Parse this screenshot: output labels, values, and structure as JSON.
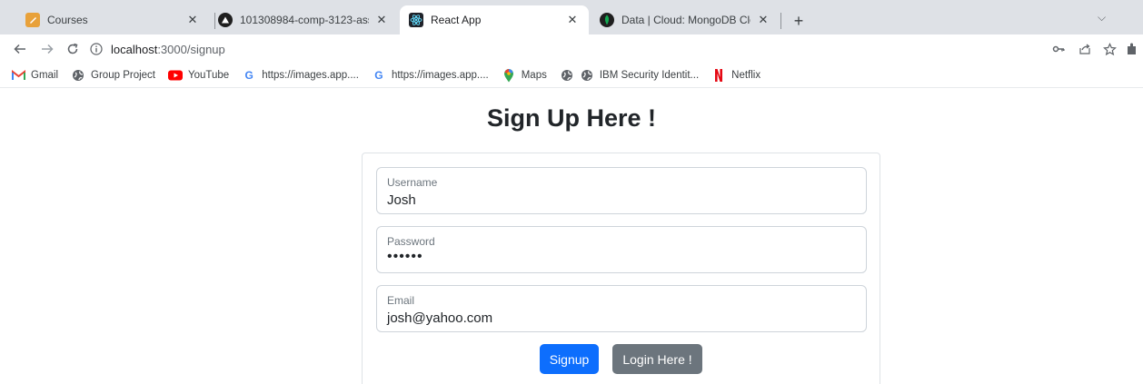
{
  "browser": {
    "tabs": [
      {
        "title": "Courses",
        "active": false
      },
      {
        "title": "101308984-comp-3123-assignme",
        "active": false
      },
      {
        "title": "React App",
        "active": true
      },
      {
        "title": "Data | Cloud: MongoDB Cloud",
        "active": false
      }
    ],
    "close_glyph": "✕",
    "new_tab_glyph": "+",
    "tab_search_glyph": "⌵",
    "url_host": "localhost",
    "url_path": ":3000/signup"
  },
  "bookmarks": [
    {
      "label": "Gmail",
      "icon": "gmail-icon"
    },
    {
      "label": "Group Project",
      "icon": "globe-icon"
    },
    {
      "label": "YouTube",
      "icon": "youtube-icon"
    },
    {
      "label": "https://images.app....",
      "icon": "google-icon"
    },
    {
      "label": "https://images.app....",
      "icon": "google-icon"
    },
    {
      "label": "Maps",
      "icon": "maps-icon"
    },
    {
      "label": "",
      "icon": "globe-icon"
    },
    {
      "label": "IBM Security Identit...",
      "icon": "globe-icon"
    },
    {
      "label": "Netflix",
      "icon": "netflix-icon"
    }
  ],
  "page": {
    "title": "Sign Up Here !",
    "fields": {
      "username": {
        "label": "Username",
        "value": "Josh"
      },
      "password": {
        "label": "Password",
        "value": "••••••"
      },
      "email": {
        "label": "Email",
        "value": "josh@yahoo.com"
      }
    },
    "signup_label": "Signup",
    "login_label": "Login Here !"
  },
  "colors": {
    "primary": "#0d6efd",
    "secondary": "#6c757d",
    "tabstrip": "#dee1e6"
  }
}
